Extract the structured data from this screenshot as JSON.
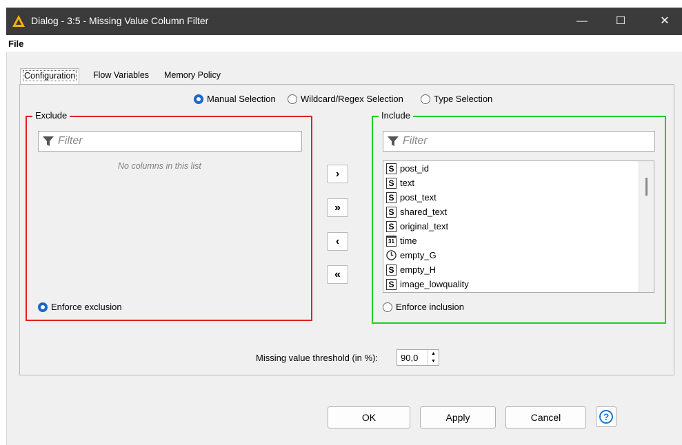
{
  "window": {
    "title": "Dialog - 3:5 - Missing Value Column Filter",
    "minimize": "—",
    "maximize": "☐",
    "close": "✕"
  },
  "menu": {
    "file": "File"
  },
  "tabs": [
    {
      "label": "Configuration",
      "active": true
    },
    {
      "label": "Flow Variables",
      "active": false
    },
    {
      "label": "Memory Policy",
      "active": false
    }
  ],
  "mode": {
    "manual": "Manual Selection",
    "wildcard": "Wildcard/Regex Selection",
    "type": "Type Selection",
    "selected": "manual"
  },
  "exclude": {
    "legend": "Exclude",
    "filter_placeholder": "Filter",
    "empty_message": "No columns in this list",
    "enforce_label": "Enforce exclusion",
    "enforce_checked": true,
    "border_color": "#e02020"
  },
  "include": {
    "legend": "Include",
    "filter_placeholder": "Filter",
    "enforce_label": "Enforce inclusion",
    "enforce_checked": false,
    "border_color": "#22cc22",
    "columns": [
      {
        "type": "S",
        "name": "post_id"
      },
      {
        "type": "S",
        "name": "text"
      },
      {
        "type": "S",
        "name": "post_text"
      },
      {
        "type": "S",
        "name": "shared_text"
      },
      {
        "type": "S",
        "name": "original_text"
      },
      {
        "type": "31",
        "name": "time"
      },
      {
        "type": "clock",
        "name": "empty_G"
      },
      {
        "type": "S",
        "name": "empty_H"
      },
      {
        "type": "S",
        "name": "image_lowquality"
      }
    ]
  },
  "arrows": {
    "add": "›",
    "add_all": "»",
    "remove": "‹",
    "remove_all": "«"
  },
  "threshold": {
    "label": "Missing value threshold (in %):",
    "value": "90,0"
  },
  "buttons": {
    "ok": "OK",
    "apply": "Apply",
    "cancel": "Cancel",
    "help": "?"
  },
  "colors": {
    "titlebar": "#3b3b3b",
    "accent": "#1a68c5"
  }
}
